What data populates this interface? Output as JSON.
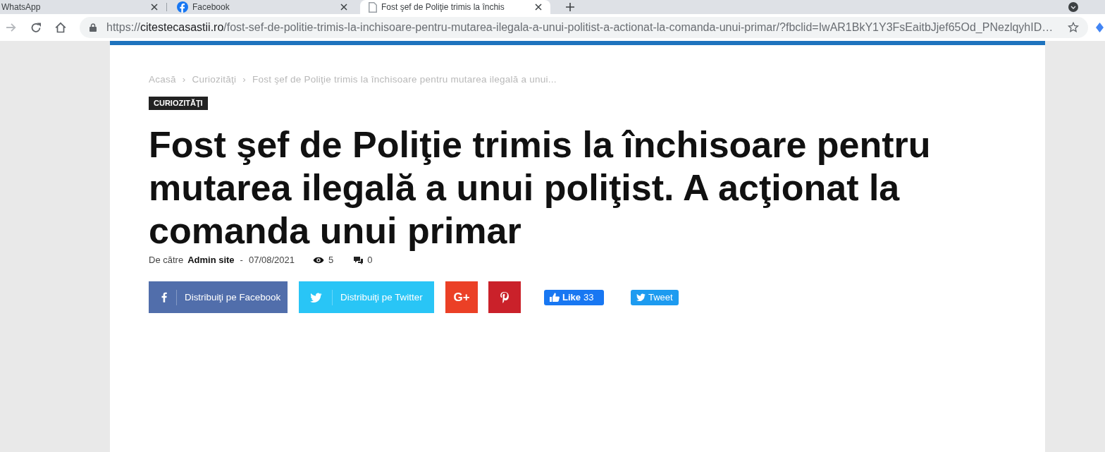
{
  "browser": {
    "tabs": [
      {
        "kind": "plain",
        "title": "WhatsApp",
        "selected": false
      },
      {
        "kind": "facebook",
        "title": "Facebook",
        "selected": false
      },
      {
        "kind": "page",
        "title": "Fost şef de Poliţie trimis la închis",
        "selected": true
      }
    ],
    "forward_disabled": true,
    "address": {
      "scheme": "https://",
      "host": "citestecasastii.ro",
      "path": "/fost-sef-de-politie-trimis-la-inchisoare-pentru-mutarea-ilegala-a-unui-politist-a-actionat-la-comanda-unui-primar/?fbclid=IwAR1BkY1Y3FsEaitbJjef65Od_PNezlqyhID…"
    }
  },
  "article": {
    "breadcrumb": [
      {
        "kind": "link",
        "text": "Acasă"
      },
      {
        "kind": "separator",
        "text": "›"
      },
      {
        "kind": "link",
        "text": "Curiozităţi"
      },
      {
        "kind": "separator",
        "text": "›"
      },
      {
        "kind": "current",
        "text": "Fost şef de Poliţie trimis la închisoare pentru mutarea ilegală a unui..."
      }
    ],
    "category": "CURIOZITĂŢI",
    "title": "Fost şef de Poliţie trimis la închisoare pentru mutarea ilegală a unui poliţist. A acţionat la comanda unui primar",
    "meta": {
      "by_label": "De către",
      "author": "Admin site",
      "separator": "-",
      "date": "07/08/2021",
      "views": "5",
      "comments": "0"
    },
    "share_buttons": [
      {
        "kind": "facebook",
        "label": "Distribuiţi pe Facebook",
        "color": "#516eab"
      },
      {
        "kind": "twitter",
        "label": "Distribuiţi pe Twitter",
        "color": "#29c5f6"
      },
      {
        "kind": "googleplus",
        "label": "G+",
        "color": "#eb4026"
      },
      {
        "kind": "pinterest",
        "color": "#ca212a"
      }
    ],
    "social_widgets": [
      {
        "kind": "like",
        "label": "Like",
        "count": "33"
      },
      {
        "kind": "tweet",
        "label": "Tweet"
      }
    ]
  }
}
